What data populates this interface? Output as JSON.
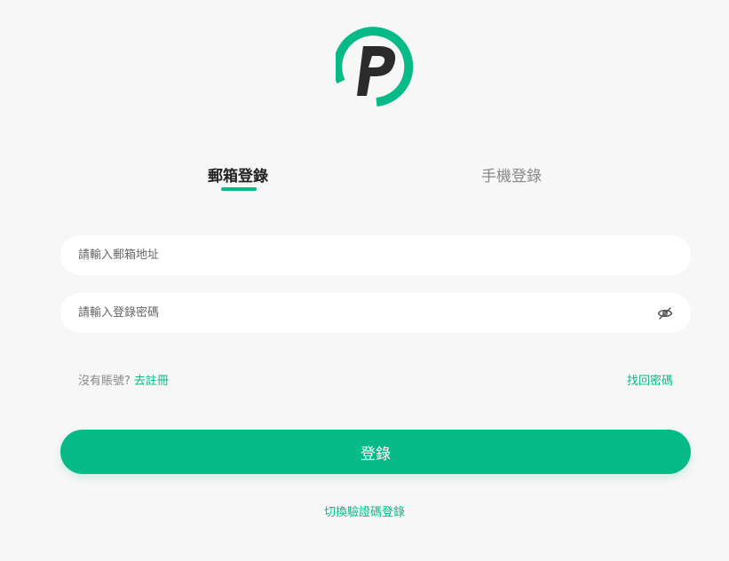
{
  "colors": {
    "accent": "#08ba87",
    "logo_letter": "#2b2b2b",
    "background": "#f7f7f7"
  },
  "logo": {
    "icon": "p-logo-icon"
  },
  "tabs": {
    "email": "郵箱登錄",
    "phone": "手機登錄",
    "active": "email"
  },
  "form": {
    "email_placeholder": "請輸入郵箱地址",
    "email_value": "",
    "password_placeholder": "請輸入登錄密碼",
    "password_value": "",
    "password_toggle_icon": "eye-off-icon"
  },
  "links": {
    "no_account": "沒有賬號?",
    "register": "去註冊",
    "forgot_password": "找回密碼"
  },
  "login_button": "登錄",
  "switch_login": "切換驗證碼登錄"
}
